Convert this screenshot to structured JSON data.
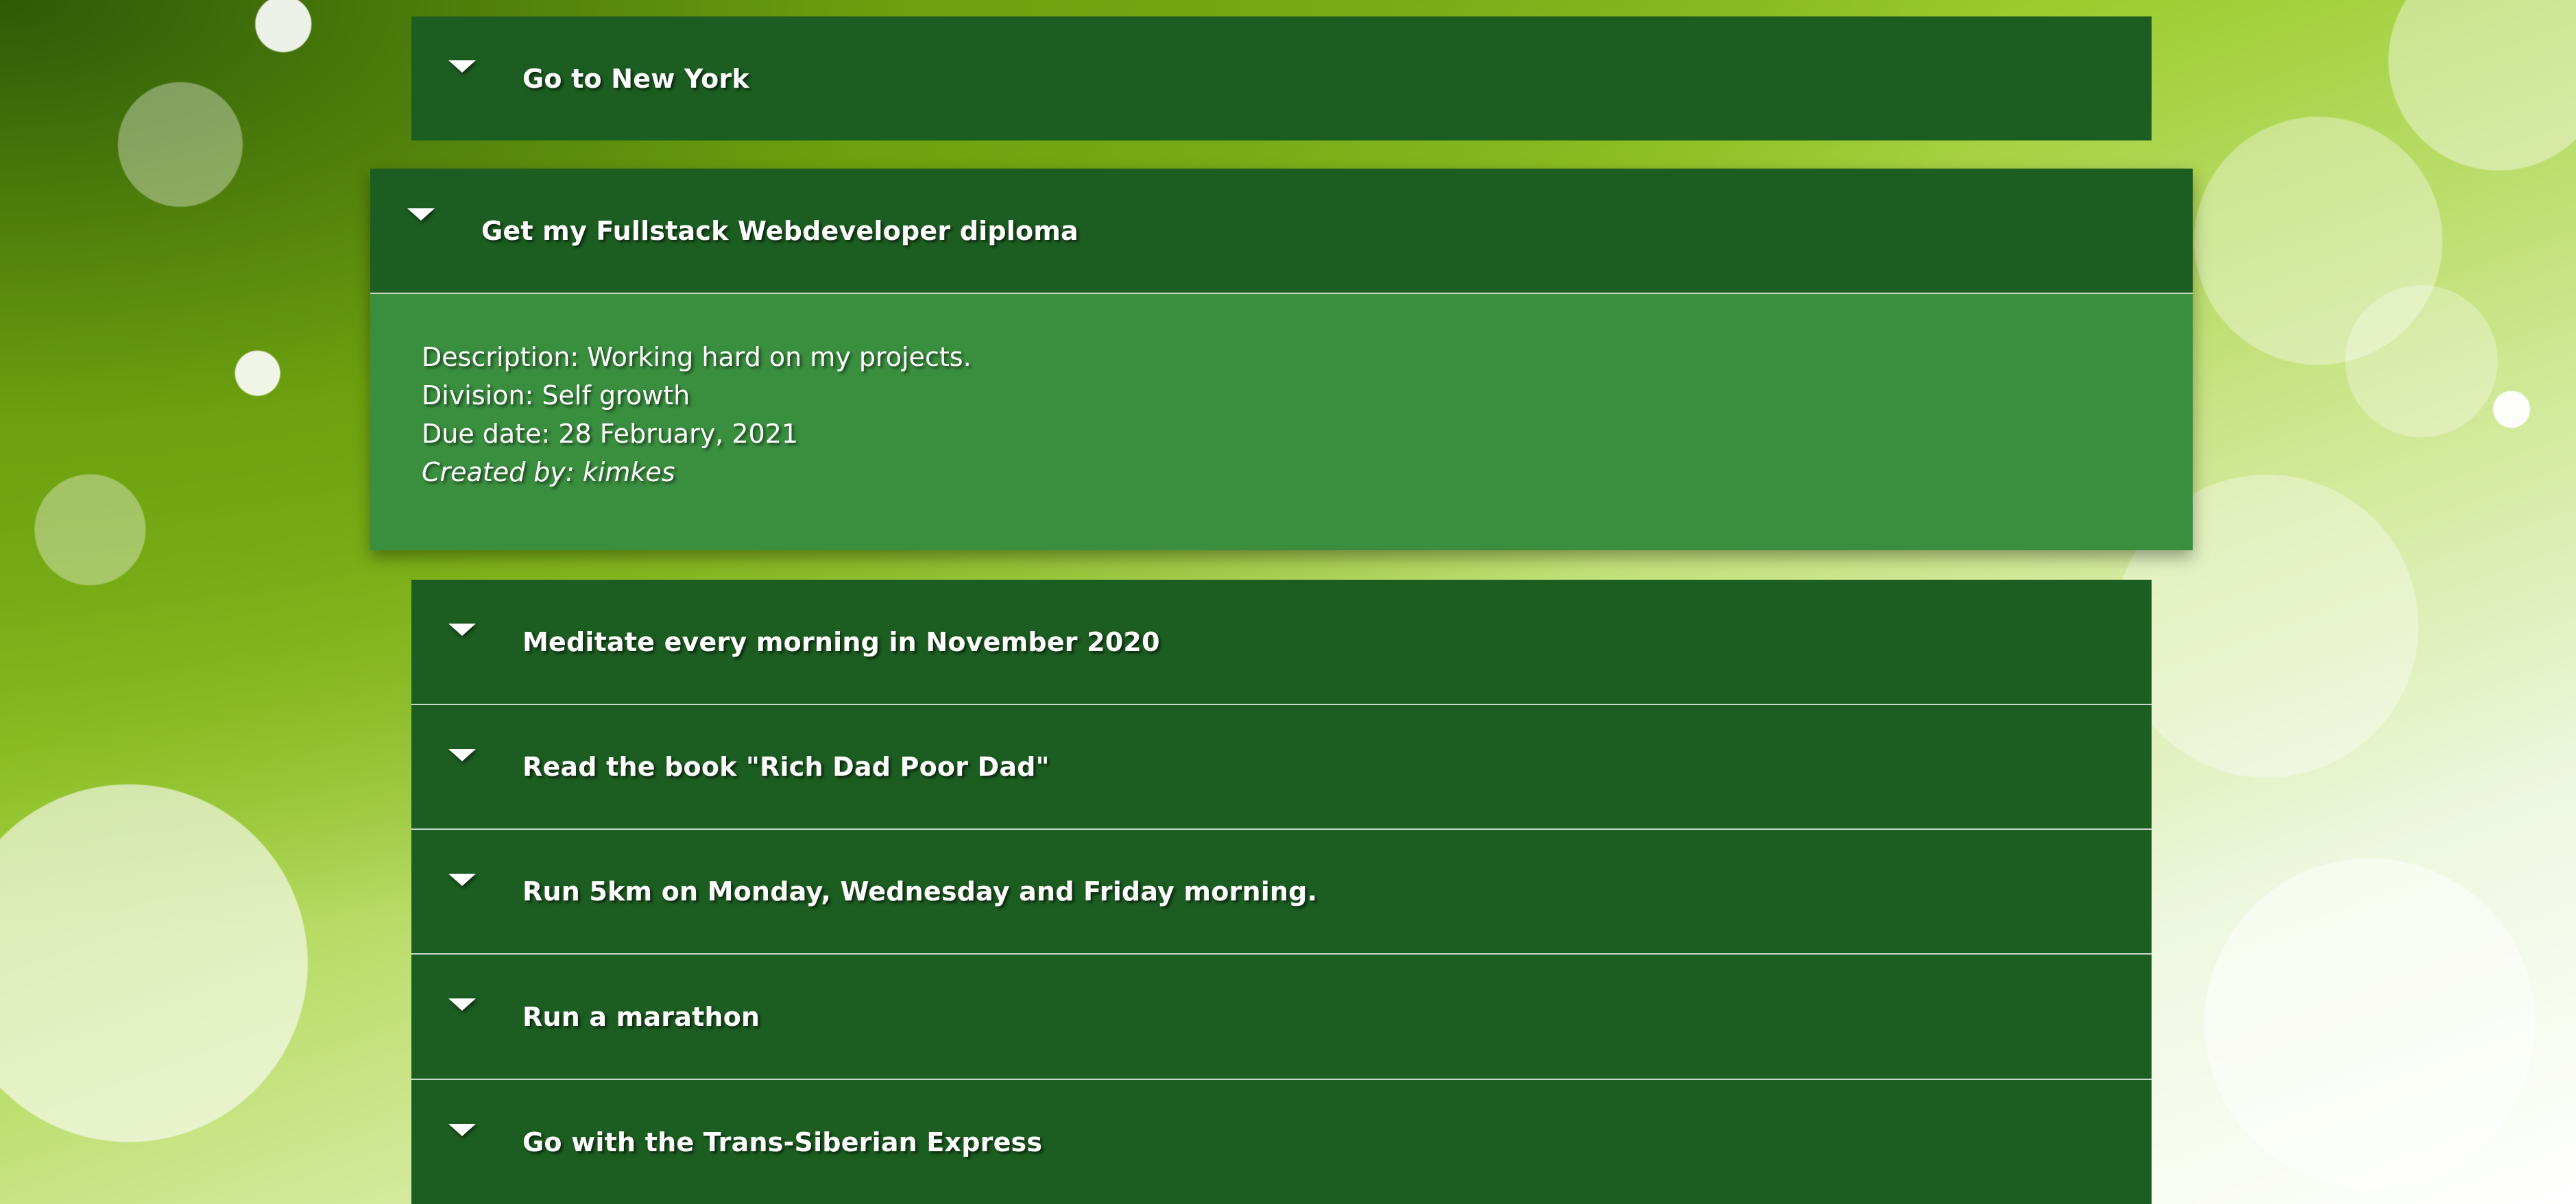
{
  "goals": [
    {
      "title": "Go to New York",
      "expanded": false
    },
    {
      "title": "Get my Fullstack Webdeveloper diploma",
      "expanded": true,
      "details": {
        "description": "Description: Working hard on my projects.",
        "division": "Division: Self growth",
        "due_date": "Due date: 28 February, 2021",
        "created_by": "Created by: kimkes"
      }
    },
    {
      "title": "Meditate every morning in November 2020",
      "expanded": false
    },
    {
      "title": "Read the book \"Rich Dad Poor Dad\"",
      "expanded": false
    },
    {
      "title": "Run 5km on Monday, Wednesday and Friday morning.",
      "expanded": false
    },
    {
      "title": "Run a marathon",
      "expanded": false
    },
    {
      "title": "Go with the Trans-Siberian Express",
      "expanded": false
    }
  ],
  "colors": {
    "header_bg": "#1c5e21",
    "expanded_body_bg": "#3a8f3f",
    "text": "#ffffff",
    "divider": "#c9d7c9"
  },
  "icons": {
    "toggle": "caret-down-icon"
  }
}
